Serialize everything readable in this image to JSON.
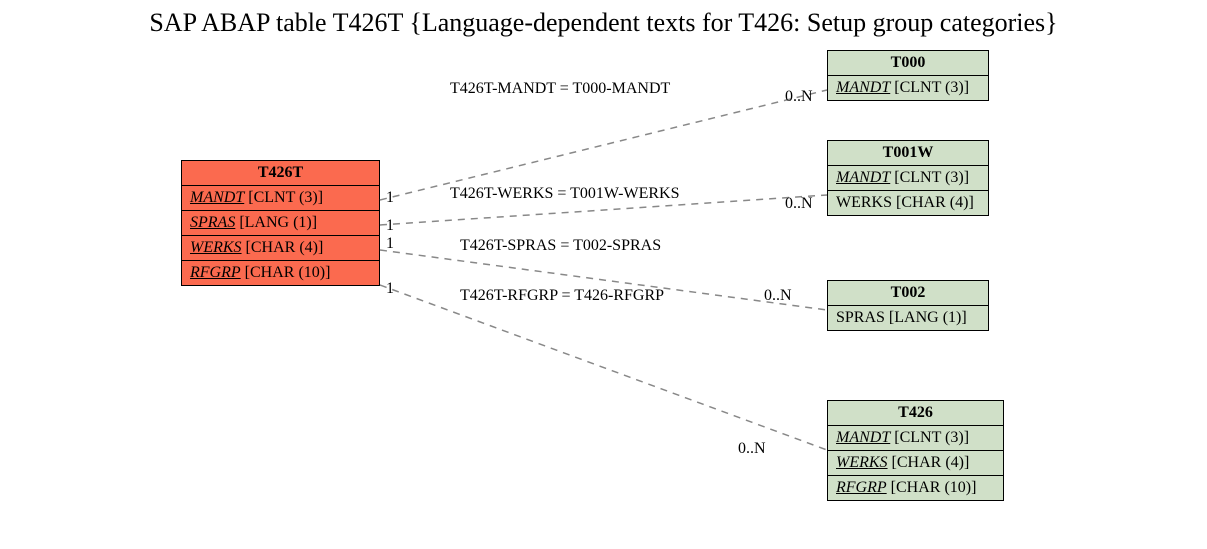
{
  "title": "SAP ABAP table T426T {Language-dependent texts for T426: Setup group categories}",
  "source": {
    "name": "T426T",
    "fields": [
      {
        "name": "MANDT",
        "type": "[CLNT (3)]",
        "key": true
      },
      {
        "name": "SPRAS",
        "type": "[LANG (1)]",
        "key": true
      },
      {
        "name": "WERKS",
        "type": "[CHAR (4)]",
        "key": true
      },
      {
        "name": "RFGRP",
        "type": "[CHAR (10)]",
        "key": true
      }
    ]
  },
  "targets": [
    {
      "name": "T000",
      "fields": [
        {
          "name": "MANDT",
          "type": "[CLNT (3)]",
          "key": true
        }
      ]
    },
    {
      "name": "T001W",
      "fields": [
        {
          "name": "MANDT",
          "type": "[CLNT (3)]",
          "key": true
        },
        {
          "name": "WERKS",
          "type": "[CHAR (4)]",
          "key": false
        }
      ]
    },
    {
      "name": "T002",
      "fields": [
        {
          "name": "SPRAS",
          "type": "[LANG (1)]",
          "key": false
        }
      ]
    },
    {
      "name": "T426",
      "fields": [
        {
          "name": "MANDT",
          "type": "[CLNT (3)]",
          "key": true
        },
        {
          "name": "WERKS",
          "type": "[CHAR (4)]",
          "key": true
        },
        {
          "name": "RFGRP",
          "type": "[CHAR (10)]",
          "key": true
        }
      ]
    }
  ],
  "relations": [
    {
      "label": "T426T-MANDT = T000-MANDT",
      "src_card": "1",
      "dst_card": "0..N"
    },
    {
      "label": "T426T-WERKS = T001W-WERKS",
      "src_card": "1",
      "dst_card": "0..N"
    },
    {
      "label": "T426T-SPRAS = T002-SPRAS",
      "src_card": "1",
      "dst_card": ""
    },
    {
      "label": "T426T-RFGRP = T426-RFGRP",
      "src_card": "1",
      "dst_card": "0..N"
    }
  ]
}
